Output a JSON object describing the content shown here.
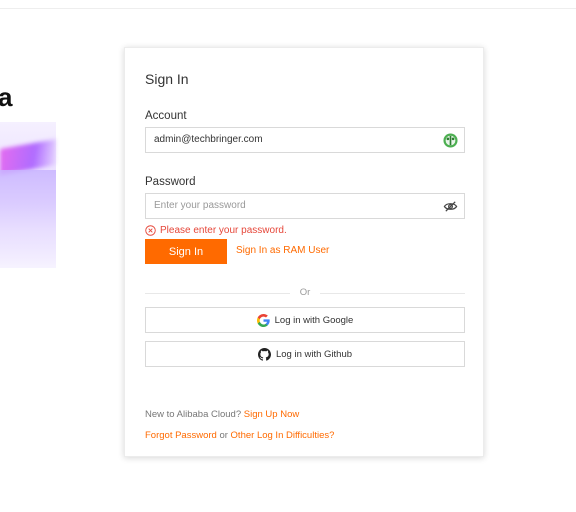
{
  "hero": {
    "title_fragment": "a"
  },
  "signin": {
    "title": "Sign In",
    "account_label": "Account",
    "account_value": "admin@techbringer.com",
    "password_label": "Password",
    "password_placeholder": "Enter your password",
    "error_text": "Please enter your password.",
    "signin_button": "Sign In",
    "ram_link": "Sign In as RAM User",
    "or_text": "Or",
    "google_button": "Log in with Google",
    "github_button": "Log in with Github",
    "new_text": "New to Alibaba Cloud?",
    "signup_link": "Sign Up Now",
    "forgot_link": "Forgot Password",
    "or_word": "or",
    "other_link": "Other Log In Difficulties?"
  },
  "icons": {
    "account_field_icon": "password-manager-icon",
    "password_field_icon": "eye-slash-icon",
    "error_icon": "error-circle-icon",
    "google_icon": "google-icon",
    "github_icon": "github-icon"
  },
  "colors": {
    "accent": "#ff6a00",
    "error": "#e6473a"
  }
}
